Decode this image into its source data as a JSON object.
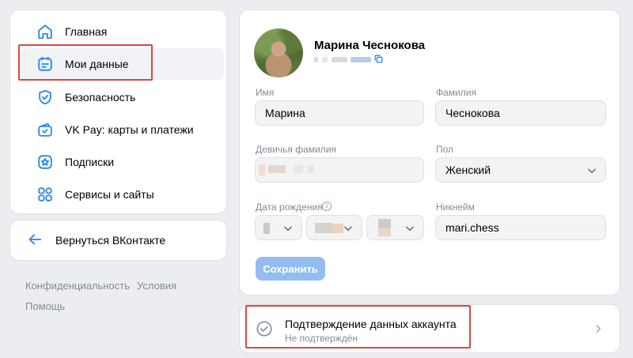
{
  "sidebar": {
    "items": [
      {
        "label": "Главная",
        "icon": "home-icon"
      },
      {
        "label": "Мои данные",
        "icon": "my-data-icon"
      },
      {
        "label": "Безопасность",
        "icon": "shield-icon"
      },
      {
        "label": "VK Pay: карты и платежи",
        "icon": "wallet-icon"
      },
      {
        "label": "Подписки",
        "icon": "star-subscriptions-icon"
      },
      {
        "label": "Сервисы и сайты",
        "icon": "services-grid-icon"
      }
    ],
    "active_index": 1,
    "back_label": "Вернуться ВКонтакте",
    "footer": {
      "privacy": "Конфиденциальность",
      "terms": "Условия",
      "help": "Помощь"
    }
  },
  "profile": {
    "name": "Марина Чеснокова",
    "fields": {
      "first_name": {
        "label": "Имя",
        "value": "Марина"
      },
      "last_name": {
        "label": "Фамилия",
        "value": "Чеснокова"
      },
      "maiden_name": {
        "label": "Девичья фамилия"
      },
      "gender": {
        "label": "Пол",
        "value": "Женский"
      },
      "birth_date": {
        "label": "Дата рождения"
      },
      "nickname": {
        "label": "Никнейм",
        "value": "mari.chess"
      }
    },
    "save_label": "Сохранить"
  },
  "verification": {
    "title": "Подтверждение данных аккаунта",
    "status": "Не подтверждён"
  },
  "colors": {
    "accent": "#2688eb",
    "highlight_border": "#e0463e",
    "save_button": "#93bdf0",
    "page_background": "#ebedf0"
  }
}
